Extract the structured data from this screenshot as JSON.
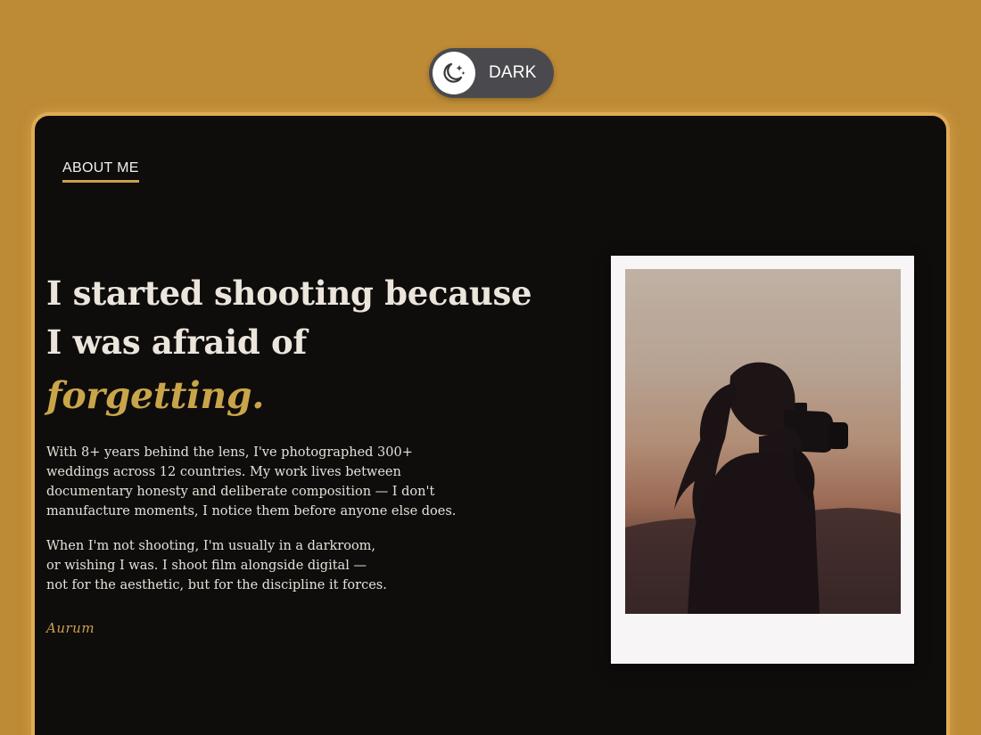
{
  "theme_toggle": {
    "label": "DARK",
    "icon": "moon-stars-icon"
  },
  "about": {
    "section_label": "ABOUT ME",
    "headline": "I started shooting because I was afraid of",
    "headline_accent": "forgetting.",
    "paragraph_1": "With 8+ years behind the lens, I've photographed 300+\nweddings across 12 countries. My work lives between\ndocumentary honesty and deliberate composition — I don't\nmanufacture moments, I notice them before anyone else does.",
    "paragraph_2": "When I'm not shooting, I'm usually in a darkroom,\nor wishing I was. I shoot film alongside digital —\nnot for the aesthetic, but for the discipline it forces.",
    "signature": "Aurum"
  },
  "photo": {
    "subject": "silhouette-photographer-with-camera"
  },
  "colors": {
    "page_background": "#bd8a35",
    "card_background": "#0f0c0c",
    "card_border": "#e0aa55",
    "accent_gold": "#c9a54a",
    "toggle_background": "#4a4a4e"
  }
}
